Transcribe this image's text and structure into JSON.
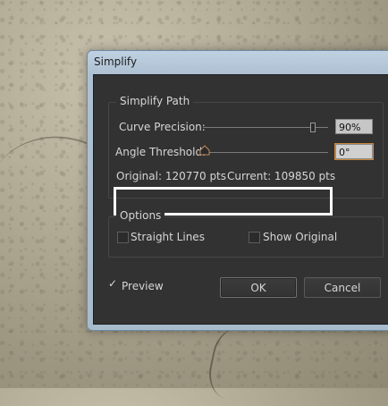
{
  "window": {
    "title": "Simplify"
  },
  "simplify_path": {
    "legend": "Simplify Path",
    "curve_precision": {
      "label": "Curve Precision:",
      "value": "90%",
      "level": 0.9
    },
    "angle_threshold": {
      "label": "Angle Threshold:",
      "value": "0°",
      "level": 0.0
    },
    "stats": {
      "original": "Original: 120770 pts",
      "current": "Current: 109850 pts"
    }
  },
  "options": {
    "legend": "Options",
    "straight_lines": {
      "label": "Straight Lines",
      "checked": false
    },
    "show_original": {
      "label": "Show Original",
      "checked": false
    }
  },
  "preview": {
    "label": "Preview",
    "checked": true
  },
  "buttons": {
    "ok": "OK",
    "cancel": "Cancel"
  }
}
